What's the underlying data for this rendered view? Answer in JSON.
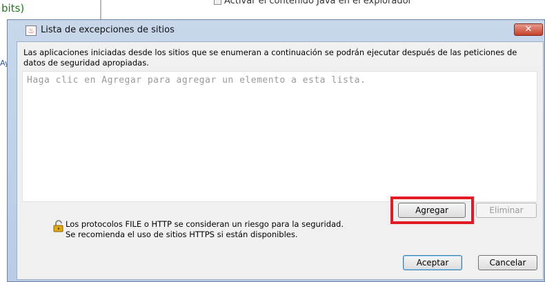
{
  "background": {
    "left_text": "bits)",
    "left_link": "Ay",
    "top_text": "Activar el contenido Java en el explorador"
  },
  "dialog": {
    "title": "Lista de excepciones de sitios",
    "close_symbol": "✕",
    "icon": "java-icon",
    "description": "Las aplicaciones iniciadas desde los sitios que se enumeran a continuación se podrán ejecutar después de las peticiones de datos de seguridad apropiadas.",
    "list_placeholder": "Haga clic en Agregar para agregar un elemento a esta lista.",
    "buttons": {
      "add": "Agregar",
      "remove": "Eliminar",
      "ok": "Aceptar",
      "cancel": "Cancelar"
    },
    "warning": {
      "icon": "lock-icon",
      "line1": "Los protocolos FILE o HTTP se consideran un riesgo para la seguridad.",
      "line2": "Se recomienda el uso de sitios HTTPS si están disponibles."
    }
  },
  "colors": {
    "highlight": "#e01b24",
    "title_bar": "#b9cce4",
    "close_button": "#c8412a"
  }
}
